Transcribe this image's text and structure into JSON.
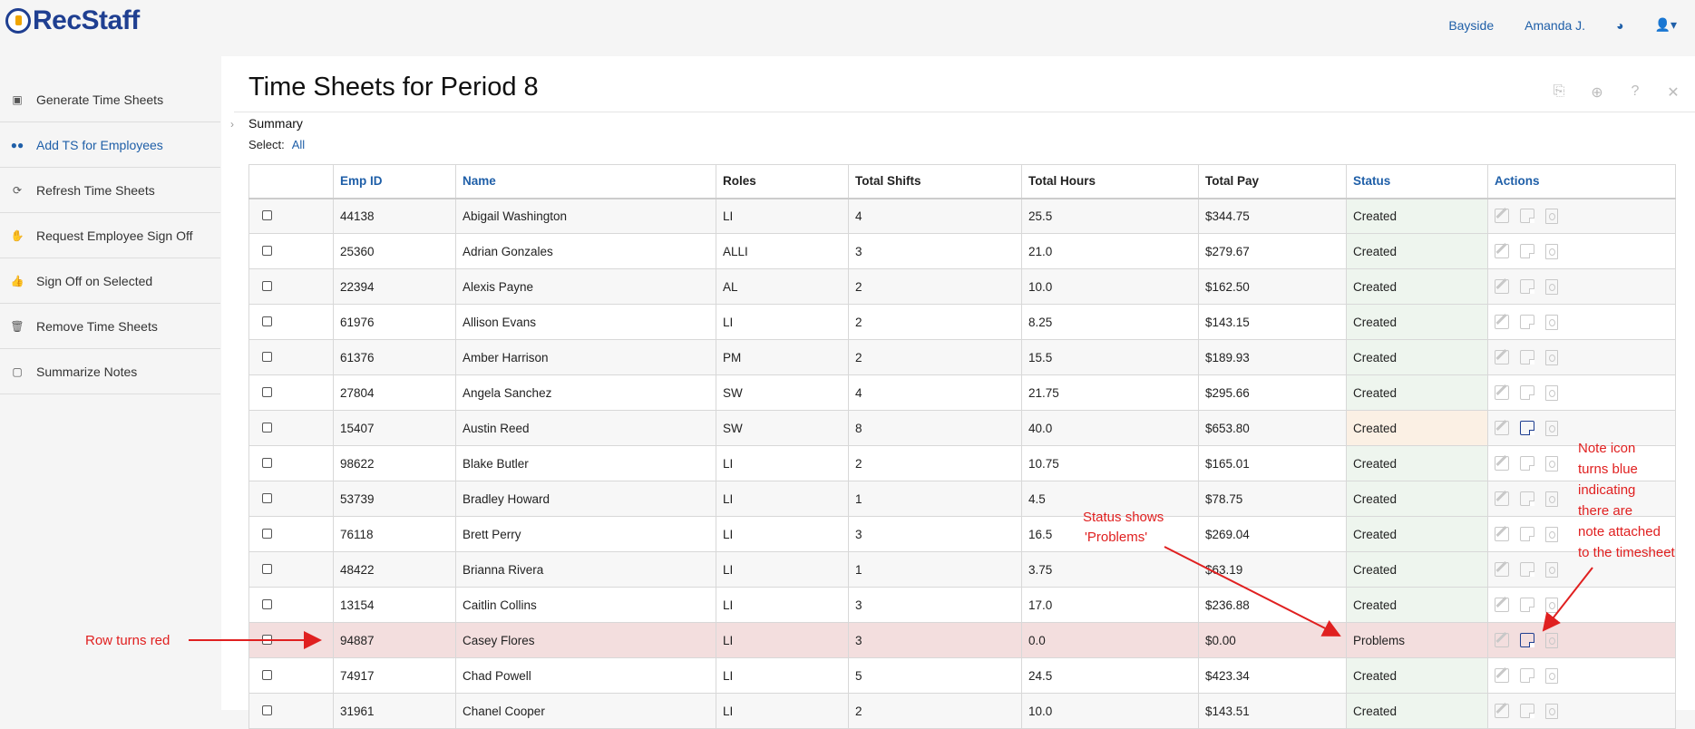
{
  "app": {
    "name": "RecStaff"
  },
  "topnav": {
    "location": "Bayside",
    "user": "Amanda J."
  },
  "sidebar": {
    "items": [
      {
        "label": "Generate Time Sheets",
        "icon": "calendar-check-icon"
      },
      {
        "label": "Add TS for Employees",
        "icon": "users-icon"
      },
      {
        "label": "Refresh Time Sheets",
        "icon": "refresh-icon"
      },
      {
        "label": "Request Employee Sign Off",
        "icon": "hand-icon"
      },
      {
        "label": "Sign Off on Selected",
        "icon": "thumbs-up-icon"
      },
      {
        "label": "Remove Time Sheets",
        "icon": "trash-icon"
      },
      {
        "label": "Summarize Notes",
        "icon": "note-icon"
      }
    ]
  },
  "main": {
    "title": "Time Sheets for Period 8",
    "summary": "Summary",
    "select_label": "Select:",
    "select_all": "All"
  },
  "table": {
    "headers": [
      "Emp ID",
      "Name",
      "Roles",
      "Total Shifts",
      "Total Hours",
      "Total Pay",
      "Status",
      "Actions"
    ],
    "rows": [
      {
        "id": "44138",
        "name": "Abigail Washington",
        "roles": "LI",
        "shifts": "4",
        "hours": "25.5",
        "pay": "$344.75",
        "status": "Created",
        "note": false
      },
      {
        "id": "25360",
        "name": "Adrian Gonzales",
        "roles": "ALLI",
        "shifts": "3",
        "hours": "21.0",
        "pay": "$279.67",
        "status": "Created",
        "note": false
      },
      {
        "id": "22394",
        "name": "Alexis Payne",
        "roles": "AL",
        "shifts": "2",
        "hours": "10.0",
        "pay": "$162.50",
        "status": "Created",
        "note": false
      },
      {
        "id": "61976",
        "name": "Allison Evans",
        "roles": "LI",
        "shifts": "2",
        "hours": "8.25",
        "pay": "$143.15",
        "status": "Created",
        "note": false
      },
      {
        "id": "61376",
        "name": "Amber Harrison",
        "roles": "PM",
        "shifts": "2",
        "hours": "15.5",
        "pay": "$189.93",
        "status": "Created",
        "note": false
      },
      {
        "id": "27804",
        "name": "Angela Sanchez",
        "roles": "SW",
        "shifts": "4",
        "hours": "21.75",
        "pay": "$295.66",
        "status": "Created",
        "note": false
      },
      {
        "id": "15407",
        "name": "Austin Reed",
        "roles": "SW",
        "shifts": "8",
        "hours": "40.0",
        "pay": "$653.80",
        "status": "Created",
        "note": true,
        "warn": true
      },
      {
        "id": "98622",
        "name": "Blake Butler",
        "roles": "LI",
        "shifts": "2",
        "hours": "10.75",
        "pay": "$165.01",
        "status": "Created",
        "note": false
      },
      {
        "id": "53739",
        "name": "Bradley Howard",
        "roles": "LI",
        "shifts": "1",
        "hours": "4.5",
        "pay": "$78.75",
        "status": "Created",
        "note": false
      },
      {
        "id": "76118",
        "name": "Brett Perry",
        "roles": "LI",
        "shifts": "3",
        "hours": "16.5",
        "pay": "$269.04",
        "status": "Created",
        "note": false
      },
      {
        "id": "48422",
        "name": "Brianna Rivera",
        "roles": "LI",
        "shifts": "1",
        "hours": "3.75",
        "pay": "$63.19",
        "status": "Created",
        "note": false
      },
      {
        "id": "13154",
        "name": "Caitlin Collins",
        "roles": "LI",
        "shifts": "3",
        "hours": "17.0",
        "pay": "$236.88",
        "status": "Created",
        "note": false
      },
      {
        "id": "94887",
        "name": "Casey Flores",
        "roles": "LI",
        "shifts": "3",
        "hours": "0.0",
        "pay": "$0.00",
        "status": "Problems",
        "note": true,
        "problem": true
      },
      {
        "id": "74917",
        "name": "Chad Powell",
        "roles": "LI",
        "shifts": "5",
        "hours": "24.5",
        "pay": "$423.34",
        "status": "Created",
        "note": false
      },
      {
        "id": "31961",
        "name": "Chanel Cooper",
        "roles": "LI",
        "shifts": "2",
        "hours": "10.0",
        "pay": "$143.51",
        "status": "Created",
        "note": false
      }
    ]
  },
  "annotations": {
    "row_red": "Row turns red",
    "status_line1": "Status shows",
    "status_line2": "'Problems'",
    "note_lines": [
      "Note icon",
      "turns blue",
      "indicating",
      "there are",
      "note attached",
      "to the timesheet"
    ]
  },
  "colors": {
    "brand": "#1f3f91",
    "link": "#1f5fa8",
    "annotation": "#e02020",
    "problem_row": "#f3dede"
  }
}
